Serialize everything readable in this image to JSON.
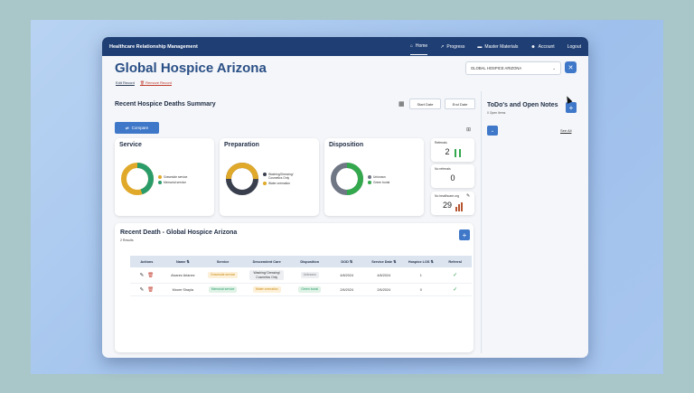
{
  "app": {
    "brand": "Healthcare Relationship Management"
  },
  "nav": [
    {
      "label": "Home",
      "icon": "home-icon",
      "glyph": "⌂",
      "active": true
    },
    {
      "label": "Progress",
      "icon": "trend-icon",
      "glyph": "↗",
      "active": false
    },
    {
      "label": "Master Materials",
      "icon": "folder-icon",
      "glyph": "▬",
      "active": false
    },
    {
      "label": "Account",
      "icon": "users-icon",
      "glyph": "☻",
      "active": false
    },
    {
      "label": "Logout",
      "icon": "",
      "glyph": "",
      "active": false
    }
  ],
  "header": {
    "title": "Global Hospice Arizona",
    "edit_link": "Edit Record",
    "remove_link": "Remove Record",
    "select_value": "GLOBAL HOSPICE ARIZONA",
    "close_glyph": "✕"
  },
  "summary": {
    "title": "Recent Hospice Deaths Summary",
    "start_date": "Start Date",
    "end_date": "End Date",
    "compare": "Compare"
  },
  "cards": {
    "service": {
      "title": "Service",
      "legend": [
        {
          "label": "Graveside service",
          "color": "#e0a92a"
        },
        {
          "label": "Memorial service",
          "color": "#2a9c6a"
        }
      ],
      "values": [
        0.55,
        0.45
      ]
    },
    "preparation": {
      "title": "Preparation",
      "legend": [
        {
          "label": "Washing/Dressing/ Cosmetics Only",
          "color": "#3a3f4e"
        },
        {
          "label": "Water cremation",
          "color": "#e0a92a"
        }
      ],
      "values": [
        0.5,
        0.5
      ]
    },
    "disposition": {
      "title": "Disposition",
      "legend": [
        {
          "label": "Unknown",
          "color": "#6f7684"
        },
        {
          "label": "Green burial",
          "color": "#33a84d"
        }
      ],
      "values": [
        0.5,
        0.5
      ]
    }
  },
  "minis": [
    {
      "label": "Referrals",
      "value": "2"
    },
    {
      "label": "No referrals",
      "value": "0"
    },
    {
      "label": "No healthcare.org",
      "value": "29"
    }
  ],
  "recent": {
    "title": "Recent Death - Global Hospice Arizona",
    "subtitle": "2 Results",
    "columns": [
      "Actions",
      "Name",
      "Service",
      "Descendent Care",
      "Disposition",
      "DOD",
      "Service Date",
      "Hospice LOS",
      "Referral"
    ],
    "rows": [
      {
        "name": "Alvarez Arianez",
        "service": "Graveside service",
        "care": "Washing/ Dressing/ Cosmetics Only",
        "disposition": "Unknown",
        "dod": "4/8/2024",
        "service_date": "4/8/2024",
        "los": "1",
        "referral": "✓"
      },
      {
        "name": "Moore Shayla",
        "service": "Memorial service",
        "care": "Water cremation",
        "disposition": "Green burial",
        "dod": "2/6/2024",
        "service_date": "2/6/2024",
        "los": "0",
        "referral": "✓"
      }
    ]
  },
  "todo": {
    "title": "ToDo's and Open Notes",
    "subtitle": "0 Open Items",
    "see_all": "See All"
  },
  "colors": {
    "primary": "#3f78c8",
    "navbar": "#1f3f74",
    "title": "#2a4f86"
  }
}
